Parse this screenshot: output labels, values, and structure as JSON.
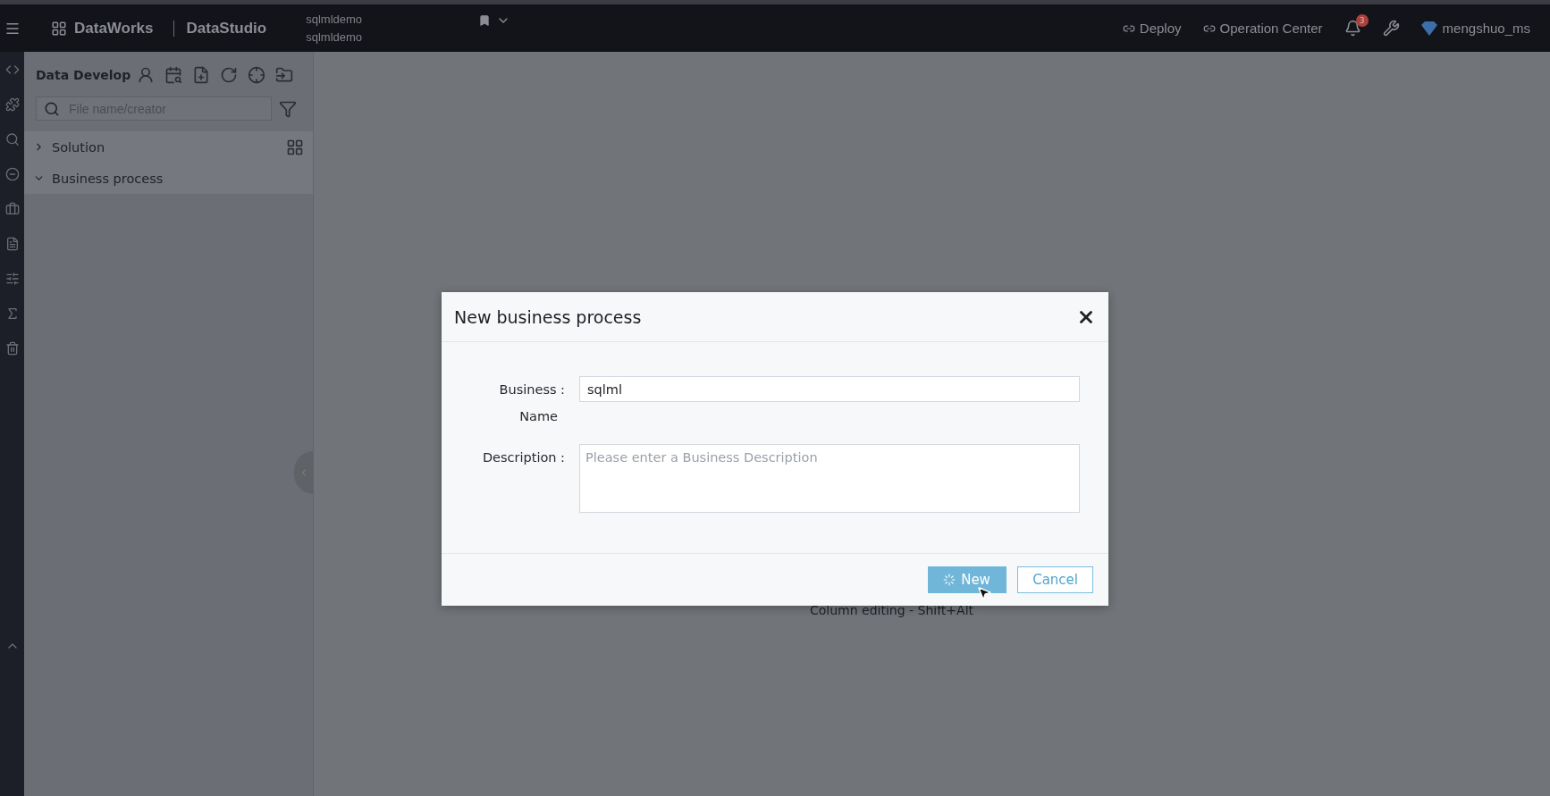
{
  "topbar": {
    "brand": "DataWorks",
    "product": "DataStudio",
    "workspace": [
      "sqlmldemo",
      "sqlmldemo"
    ],
    "links": [
      "Deploy",
      "Operation Center"
    ],
    "notification_count": "3",
    "user": "mengshuo_ms"
  },
  "sidebar": {
    "title": "Data Develop",
    "search": {
      "placeholder": "File name/creator"
    },
    "tree": [
      {
        "label": "Solution",
        "expanded": false
      },
      {
        "label": "Business process",
        "expanded": true
      }
    ]
  },
  "editor_hint": "Column editing - Shift+Alt",
  "dialog": {
    "title": "New business process",
    "fields": [
      {
        "kind": "input",
        "label_lines": [
          "Business :",
          "Name"
        ],
        "value": "sqlml"
      },
      {
        "kind": "textarea",
        "label_lines": [
          "Description :"
        ],
        "placeholder": "Please enter a Business Description"
      }
    ],
    "buttons": [
      {
        "label": "New",
        "kind": "primary",
        "loading": true
      },
      {
        "label": "Cancel",
        "kind": "secondary",
        "loading": false
      }
    ]
  }
}
